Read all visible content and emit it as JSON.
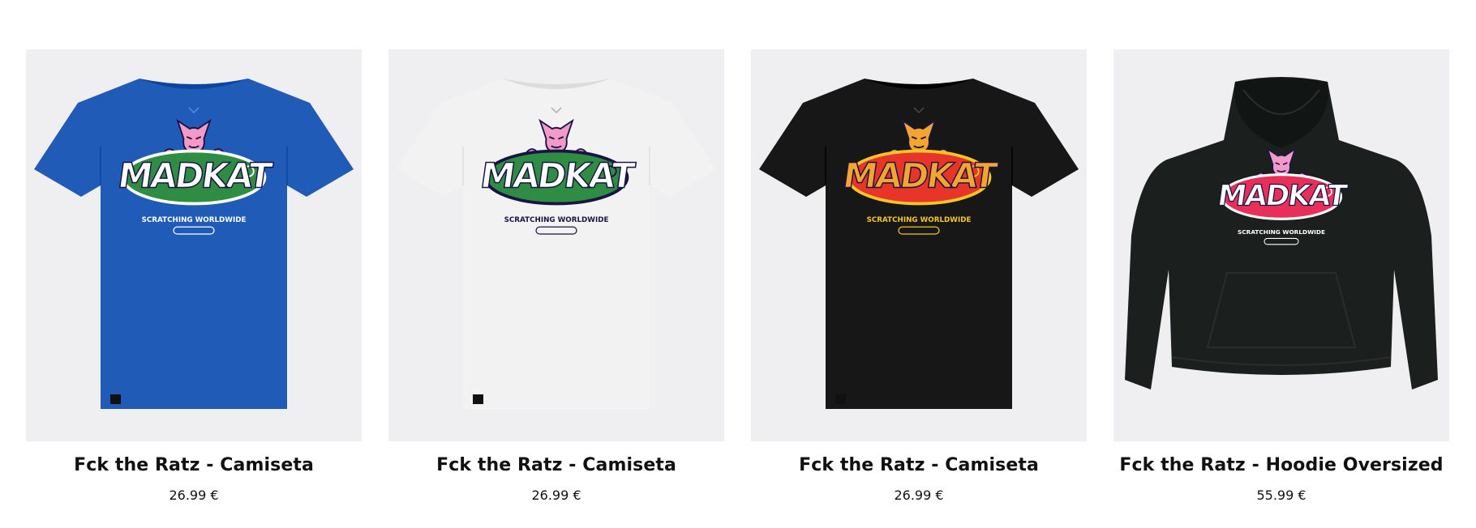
{
  "products": [
    {
      "title": "Fck the Ratz - Camiseta",
      "price": "26.99 €",
      "garment": "tshirt",
      "garment_color": "#1f5bb7",
      "graphic": {
        "logo": "MADKAT",
        "logo_color": "#ffffff",
        "oval_color": "#2f8c43",
        "oval_outline": "#ffffff",
        "cat_color": "#f39ac9",
        "tagline": "SCRATCHING WORLDWIDE",
        "tagline_color": "#ffffff"
      }
    },
    {
      "title": "Fck the Ratz - Camiseta",
      "price": "26.99 €",
      "garment": "tshirt",
      "garment_color": "#f2f2f2",
      "graphic": {
        "logo": "MADKAT",
        "logo_color": "#ffffff",
        "oval_color": "#2f8c43",
        "oval_outline": "#1a1446",
        "cat_color": "#f39ac9",
        "tagline": "SCRATCHING WORLDWIDE",
        "tagline_color": "#1a1446"
      }
    },
    {
      "title": "Fck the Ratz - Camiseta",
      "price": "26.99 €",
      "garment": "tshirt",
      "garment_color": "#171717",
      "graphic": {
        "logo": "MADKAT",
        "logo_color": "#f3a530",
        "oval_color": "#e8352a",
        "oval_outline": "#f7c623",
        "cat_color": "#f3a530",
        "tagline": "SCRATCHING WORLDWIDE",
        "tagline_color": "#f7c623"
      }
    },
    {
      "title": "Fck the Ratz - Hoodie Oversized",
      "price": "55.99 €",
      "garment": "hoodie",
      "garment_color": "#1b201f",
      "graphic": {
        "logo": "MADKAT",
        "logo_color": "#ffffff",
        "oval_color": "#e72f5a",
        "oval_outline": "#ffffff",
        "cat_color": "#f39ac9",
        "tagline": "SCRATCHING WORLDWIDE",
        "tagline_color": "#ffffff"
      }
    }
  ]
}
